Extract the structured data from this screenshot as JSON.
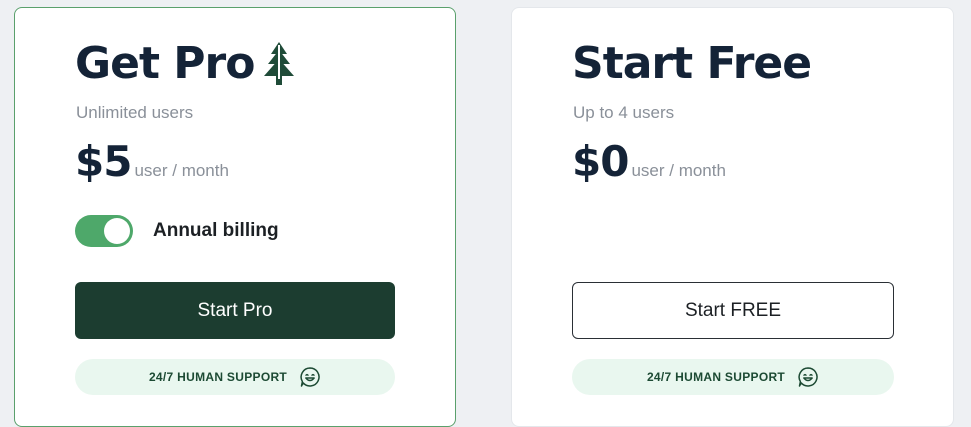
{
  "plans": {
    "pro": {
      "title": "Get Pro",
      "title_icon": "pine-tree-icon",
      "subtitle": "Unlimited users",
      "price": "$5",
      "price_unit": "user / month",
      "billing_toggle": {
        "label": "Annual billing",
        "on": true
      },
      "cta_label": "Start Pro",
      "support_label": "24/7 HUMAN SUPPORT",
      "support_icon": "smile-chat-icon"
    },
    "free": {
      "title": "Start Free",
      "subtitle": "Up to 4 users",
      "price": "$0",
      "price_unit": "user / month",
      "cta_label": "Start FREE",
      "support_label": "24/7 HUMAN SUPPORT",
      "support_icon": "smile-chat-icon"
    }
  },
  "colors": {
    "page_background": "#eef0f3",
    "pro_card_border": "#5aa06c",
    "heading": "#142337",
    "muted_text": "#8a9099",
    "toggle_on": "#4ea86a",
    "primary_button": "#1c3d30",
    "support_pill": "#e9f7ef",
    "support_text": "#1c4a33"
  }
}
